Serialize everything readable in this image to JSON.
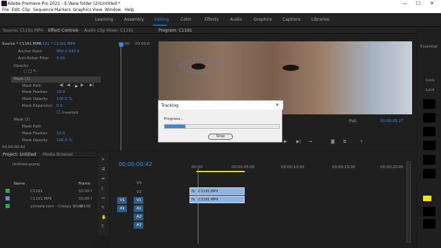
{
  "window": {
    "title": "Adobe Premiere Pro 2021 - E:\\New folder (2)\\Untitled *",
    "minimize": "—",
    "maximize": "☐",
    "close": "✕"
  },
  "menu": [
    "File",
    "Edit",
    "Clip",
    "Sequence",
    "Markers",
    "Graphics",
    "View",
    "Window",
    "Help"
  ],
  "workspaces": [
    "Learning",
    "Assembly",
    "Editing",
    "Color",
    "Effects",
    "Audio",
    "Graphics",
    "Captions",
    "Libraries"
  ],
  "active_workspace": "Editing",
  "source_tabs": [
    "Source: C1191.MP4",
    "Effect Controls",
    "Audio Clip Mixer: C1191"
  ],
  "effect_controls": {
    "clip_path": "Source * C1191.MP4",
    "clip_link": "C1191 * C1191.MP4",
    "tc_start": "00:00",
    "tc_end": "00:00:0",
    "rows": [
      {
        "label": "Anchor Point",
        "value": "960.0   540.0"
      },
      {
        "label": "Anti-flicker Filter",
        "value": "0.00"
      },
      {
        "label": "Opacity",
        "value": ""
      },
      {
        "label": "Mask (1)",
        "value": ""
      },
      {
        "label": "Mask Path",
        "value": ""
      },
      {
        "label": "Mask Feather",
        "value": "10.0"
      },
      {
        "label": "Mask Opacity",
        "value": "100.0 %"
      },
      {
        "label": "Mask Expansion",
        "value": "0.0"
      },
      {
        "label": "",
        "value": "Inverted"
      },
      {
        "label": "Mask (2)",
        "value": ""
      },
      {
        "label": "Mask Path",
        "value": ""
      },
      {
        "label": "Mask Feather",
        "value": "10.0"
      },
      {
        "label": "Mask Opacity",
        "value": "100.0 %"
      }
    ],
    "timecode": "00:00:00:42"
  },
  "program": {
    "tab": "Program: C1191",
    "fit": "Full",
    "timecode": "00:00:05:27"
  },
  "tracking_dialog": {
    "title": "Tracking",
    "close": "✕",
    "label": "Progress...",
    "progress": 0.18,
    "button": "Stop"
  },
  "project": {
    "tabs": [
      "Project: Untitled",
      "Media Browser"
    ],
    "file": "Untitled.prproj",
    "col_name": "Name",
    "col_frame": "Frame",
    "items": [
      {
        "name": "C1191",
        "frame": "50.00 f",
        "color": "#22b14c"
      },
      {
        "name": "C1191.MP4",
        "frame": "50.00 f",
        "color": "#6c8bd5"
      },
      {
        "name": "y2mate.com - Creepy Wind",
        "frame": "44100",
        "color": "#22b14c"
      }
    ]
  },
  "timeline": {
    "timecode": "00:00:00:42",
    "ruler": [
      "00:00",
      "00:00:05:00",
      "00:00:10:00",
      "00:00:15:00",
      "00:00:20:00"
    ],
    "video_tracks": [
      "V3",
      "V2",
      "V1"
    ],
    "audio_tracks": [
      "A1",
      "A2",
      "A3"
    ],
    "source_video": "V1",
    "source_audio": "A1",
    "clip_v2": "C1191.MP4",
    "clip_v1": "C1191.MP4",
    "clip_v2_badge": "fx",
    "clip_v1_badge": "fx"
  },
  "right_panel": {
    "tab": "Essential",
    "check1": "Lock",
    "check2": "Lock"
  },
  "colors": {
    "accent": "#2d8ceb",
    "clip": "#8fb3e3",
    "dialog_bg": "#f0f0f0"
  }
}
